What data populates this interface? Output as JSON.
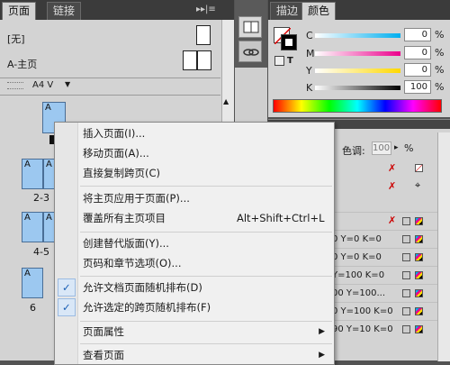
{
  "pages_panel": {
    "tabs": [
      {
        "label": "页面"
      },
      {
        "label": "链接"
      }
    ],
    "tab_menu_glyph": "▸▸|≡",
    "masters": [
      {
        "label": "[无]"
      },
      {
        "label": "A-主页"
      }
    ],
    "page_size": "A4 V",
    "spreads": [
      {
        "label": "",
        "pages": [
          "A"
        ]
      },
      {
        "label": "2-3",
        "pages": [
          "A",
          "A"
        ]
      },
      {
        "label": "4-5",
        "pages": [
          "A",
          "A"
        ]
      },
      {
        "label": "6",
        "pages": [
          "A"
        ]
      }
    ]
  },
  "color_panel": {
    "tabs": [
      {
        "label": "描边"
      },
      {
        "label": "颜色"
      }
    ],
    "sliders": [
      {
        "channel": "C",
        "value": "0",
        "unit": "%"
      },
      {
        "channel": "M",
        "value": "0",
        "unit": "%"
      },
      {
        "channel": "Y",
        "value": "0",
        "unit": "%"
      },
      {
        "channel": "K",
        "value": "100",
        "unit": "%"
      }
    ]
  },
  "swatch_panel": {
    "tint_label": "色调:",
    "tint_value": "100",
    "tint_unit": "%",
    "rows": [
      {
        "text": ""
      },
      {
        "text": ""
      },
      {
        "text": ""
      },
      {
        "text": ""
      },
      {
        "text": "0 Y=0 K=0"
      },
      {
        "text": "0 Y=0 K=0"
      },
      {
        "text": "Y=100 K=0"
      },
      {
        "text": "00 Y=100..."
      },
      {
        "text": "0 Y=100 K=0"
      },
      {
        "text": "90 Y=10 K=0"
      }
    ]
  },
  "context_menu": {
    "groups": [
      [
        {
          "label": "插入页面(I)..."
        },
        {
          "label": "移动页面(A)..."
        },
        {
          "label": "直接复制跨页(C)"
        }
      ],
      [
        {
          "label": "将主页应用于页面(P)..."
        },
        {
          "label": "覆盖所有主页项目",
          "shortcut": "Alt+Shift+Ctrl+L"
        }
      ],
      [
        {
          "label": "创建替代版面(Y)..."
        },
        {
          "label": "页码和章节选项(O)..."
        }
      ],
      [
        {
          "label": "允许文档页面随机排布(D)",
          "checked": true
        },
        {
          "label": "允许选定的跨页随机排布(F)",
          "checked": true
        }
      ],
      [
        {
          "label": "页面属性",
          "submenu": true
        }
      ],
      [
        {
          "label": "查看页面",
          "submenu": true
        }
      ]
    ]
  },
  "colors": {
    "page_thumb": "#9cc8f0",
    "accent": "#1a5fb4",
    "panel_bg": "#d3d3d3",
    "dark_bg": "#535353"
  }
}
